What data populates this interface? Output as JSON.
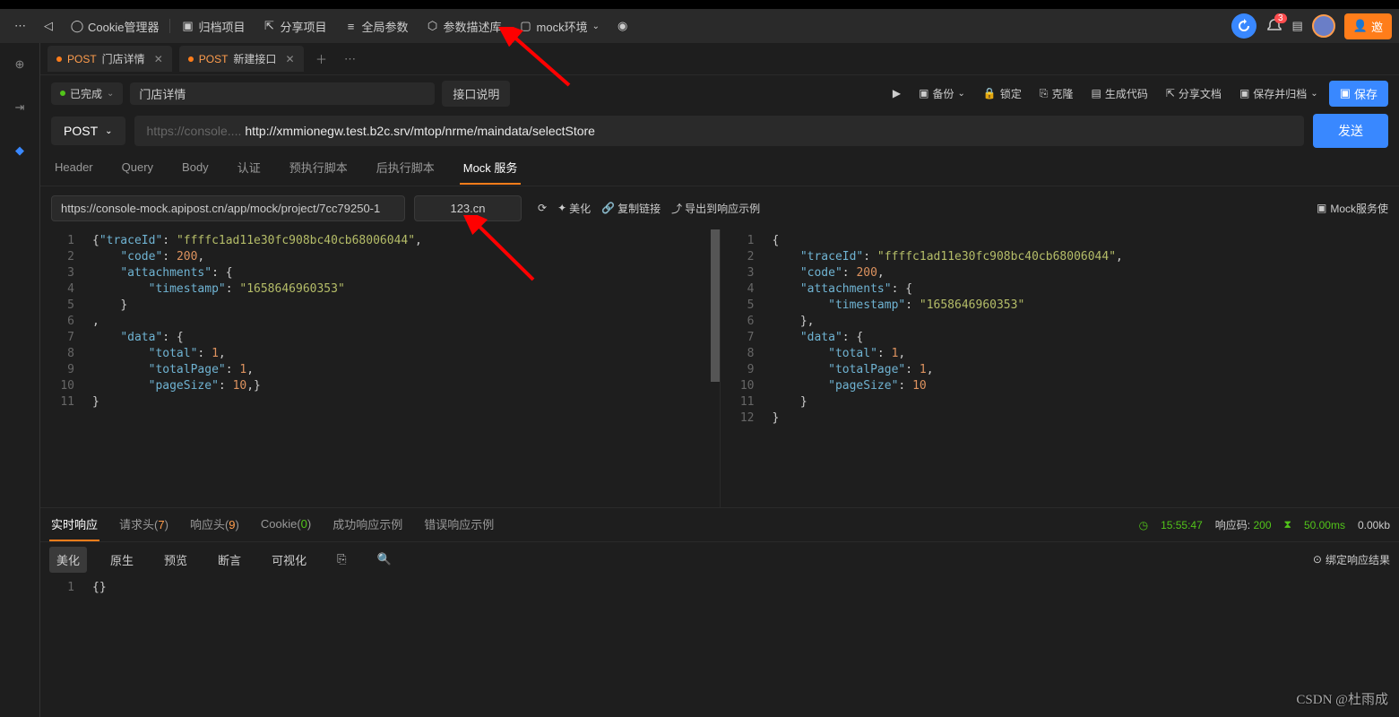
{
  "toolbar": {
    "cookie": "Cookie管理器",
    "archive": "归档项目",
    "share": "分享项目",
    "global": "全局参数",
    "params": "参数描述库",
    "mock_env": "mock环境"
  },
  "toolbar_right": {
    "bell_count": "3",
    "invite": "邀"
  },
  "tabs": [
    {
      "method": "POST",
      "name": "门店详情"
    },
    {
      "method": "POST",
      "name": "新建接口"
    }
  ],
  "status": "已完成",
  "api_name": "门店详情",
  "desc_btn": "接口说明",
  "actions": {
    "run": "",
    "backup": "备份",
    "lock": "锁定",
    "clone": "克隆",
    "gencode": "生成代码",
    "sharedoc": "分享文档",
    "savearch": "保存并归档",
    "save": "保存"
  },
  "method": "POST",
  "url_prefix": "https://console....",
  "url": "http://xmmionegw.test.b2c.srv/mtop/nrme/maindata/selectStore",
  "send": "发送",
  "sub_tabs": {
    "header": "Header",
    "query": "Query",
    "body": "Body",
    "auth": "认证",
    "pre": "预执行脚本",
    "post": "后执行脚本",
    "mock": "Mock 服务"
  },
  "mock": {
    "url": "https://console-mock.apipost.cn/app/mock/project/7cc79250-1",
    "short": "123.cn",
    "refresh": "",
    "beautify": "美化",
    "copylink": "复制链接",
    "export": "导出到响应示例",
    "usage": "Mock服务使"
  },
  "editor_left": {
    "lines": [
      "1",
      "2",
      "3",
      "4",
      "5",
      "6",
      "7",
      "8",
      "9",
      "10",
      "11"
    ],
    "code": [
      {
        "indent": 0,
        "tokens": [
          {
            "t": "pun",
            "s": "{"
          },
          {
            "t": "key",
            "s": "\"traceId\""
          },
          {
            "t": "pun",
            "s": ": "
          },
          {
            "t": "str",
            "s": "\"ffffc1ad11e30fc908bc40cb68006044\""
          },
          {
            "t": "pun",
            "s": ","
          }
        ]
      },
      {
        "indent": 1,
        "tokens": [
          {
            "t": "key",
            "s": "\"code\""
          },
          {
            "t": "pun",
            "s": ": "
          },
          {
            "t": "num",
            "s": "200"
          },
          {
            "t": "pun",
            "s": ","
          }
        ]
      },
      {
        "indent": 1,
        "tokens": [
          {
            "t": "key",
            "s": "\"attachments\""
          },
          {
            "t": "pun",
            "s": ": {"
          }
        ]
      },
      {
        "indent": 2,
        "tokens": [
          {
            "t": "key",
            "s": "\"timestamp\""
          },
          {
            "t": "pun",
            "s": ": "
          },
          {
            "t": "str",
            "s": "\"1658646960353\""
          }
        ]
      },
      {
        "indent": 1,
        "tokens": [
          {
            "t": "pun",
            "s": "}"
          }
        ]
      },
      {
        "indent": 0,
        "tokens": [
          {
            "t": "pun",
            "s": ","
          }
        ]
      },
      {
        "indent": 1,
        "tokens": [
          {
            "t": "key",
            "s": "\"data\""
          },
          {
            "t": "pun",
            "s": ": {"
          }
        ]
      },
      {
        "indent": 2,
        "tokens": [
          {
            "t": "key",
            "s": "\"total\""
          },
          {
            "t": "pun",
            "s": ": "
          },
          {
            "t": "num",
            "s": "1"
          },
          {
            "t": "pun",
            "s": ","
          }
        ]
      },
      {
        "indent": 2,
        "tokens": [
          {
            "t": "key",
            "s": "\"totalPage\""
          },
          {
            "t": "pun",
            "s": ": "
          },
          {
            "t": "num",
            "s": "1"
          },
          {
            "t": "pun",
            "s": ","
          }
        ]
      },
      {
        "indent": 2,
        "tokens": [
          {
            "t": "key",
            "s": "\"pageSize\""
          },
          {
            "t": "pun",
            "s": ": "
          },
          {
            "t": "num",
            "s": "10"
          },
          {
            "t": "pun",
            "s": ",}"
          }
        ]
      },
      {
        "indent": 0,
        "tokens": [
          {
            "t": "pun",
            "s": "}"
          }
        ]
      }
    ]
  },
  "editor_right": {
    "lines": [
      "1",
      "2",
      "3",
      "4",
      "5",
      "6",
      "7",
      "8",
      "9",
      "10",
      "11",
      "12"
    ],
    "code": [
      {
        "indent": 0,
        "tokens": [
          {
            "t": "pun",
            "s": "{"
          }
        ]
      },
      {
        "indent": 1,
        "tokens": [
          {
            "t": "key",
            "s": "\"traceId\""
          },
          {
            "t": "pun",
            "s": ": "
          },
          {
            "t": "str",
            "s": "\"ffffc1ad11e30fc908bc40cb68006044\""
          },
          {
            "t": "pun",
            "s": ","
          }
        ]
      },
      {
        "indent": 1,
        "tokens": [
          {
            "t": "key",
            "s": "\"code\""
          },
          {
            "t": "pun",
            "s": ": "
          },
          {
            "t": "num",
            "s": "200"
          },
          {
            "t": "pun",
            "s": ","
          }
        ]
      },
      {
        "indent": 1,
        "tokens": [
          {
            "t": "key",
            "s": "\"attachments\""
          },
          {
            "t": "pun",
            "s": ": {"
          }
        ]
      },
      {
        "indent": 2,
        "tokens": [
          {
            "t": "key",
            "s": "\"timestamp\""
          },
          {
            "t": "pun",
            "s": ": "
          },
          {
            "t": "str",
            "s": "\"1658646960353\""
          }
        ]
      },
      {
        "indent": 1,
        "tokens": [
          {
            "t": "pun",
            "s": "},"
          }
        ]
      },
      {
        "indent": 1,
        "tokens": [
          {
            "t": "key",
            "s": "\"data\""
          },
          {
            "t": "pun",
            "s": ": {"
          }
        ]
      },
      {
        "indent": 2,
        "tokens": [
          {
            "t": "key",
            "s": "\"total\""
          },
          {
            "t": "pun",
            "s": ": "
          },
          {
            "t": "num",
            "s": "1"
          },
          {
            "t": "pun",
            "s": ","
          }
        ]
      },
      {
        "indent": 2,
        "tokens": [
          {
            "t": "key",
            "s": "\"totalPage\""
          },
          {
            "t": "pun",
            "s": ": "
          },
          {
            "t": "num",
            "s": "1"
          },
          {
            "t": "pun",
            "s": ","
          }
        ]
      },
      {
        "indent": 2,
        "tokens": [
          {
            "t": "key",
            "s": "\"pageSize\""
          },
          {
            "t": "pun",
            "s": ": "
          },
          {
            "t": "num",
            "s": "10"
          }
        ]
      },
      {
        "indent": 1,
        "tokens": [
          {
            "t": "pun",
            "s": "}"
          }
        ]
      },
      {
        "indent": 0,
        "tokens": [
          {
            "t": "pun",
            "s": "}"
          }
        ]
      }
    ]
  },
  "response": {
    "tabs": {
      "realtime": "实时响应",
      "reqhead": "请求头(",
      "reqhead_n": "7",
      "resphead": "响应头(",
      "resphead_n": "9",
      "cookie": "Cookie(",
      "cookie_n": "0",
      "success": "成功响应示例",
      "error": "错误响应示例"
    },
    "status": {
      "time_label": "",
      "time": "15:55:47",
      "code_label": "响应码:",
      "code": "200",
      "dur": "50.00ms",
      "size": "0.00kb"
    },
    "tools": {
      "beautify": "美化",
      "raw": "原生",
      "preview": "预览",
      "assert": "断言",
      "visual": "可视化"
    },
    "bind": "绑定响应结果",
    "body_lines": [
      "1"
    ],
    "body": "{}"
  },
  "watermark": "CSDN @杜雨成"
}
